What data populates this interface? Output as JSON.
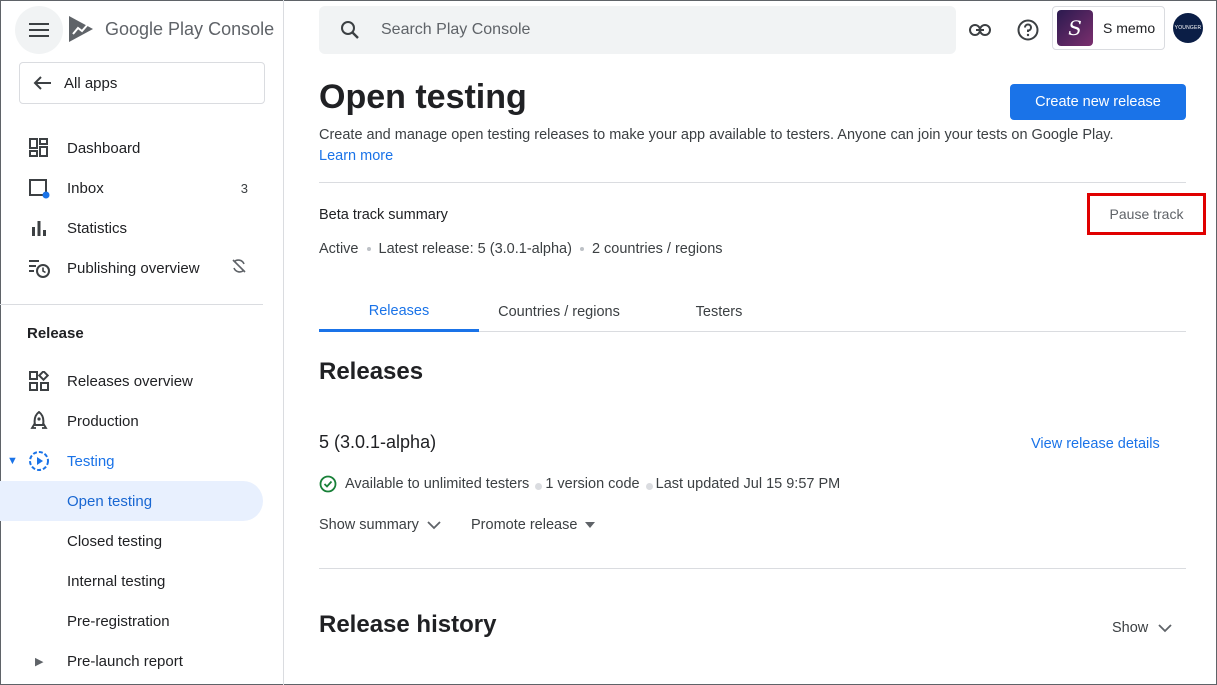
{
  "header": {
    "brand_google": "Google Play",
    "brand_console": "Console",
    "search_placeholder": "Search Play Console",
    "app_name": "S memo",
    "app_thumb_letter": "S",
    "avatar_text": "YOUNGER"
  },
  "sidebar": {
    "all_apps": "All apps",
    "items": [
      {
        "label": "Dashboard"
      },
      {
        "label": "Inbox",
        "count": "3"
      },
      {
        "label": "Statistics"
      },
      {
        "label": "Publishing overview"
      }
    ],
    "section_release": "Release",
    "release_items": [
      {
        "label": "Releases overview"
      },
      {
        "label": "Production"
      },
      {
        "label": "Testing"
      },
      {
        "label": "Open testing"
      },
      {
        "label": "Closed testing"
      },
      {
        "label": "Internal testing"
      },
      {
        "label": "Pre-registration"
      },
      {
        "label": "Pre-launch report"
      }
    ]
  },
  "main": {
    "title": "Open testing",
    "create_button": "Create new release",
    "description": "Create and manage open testing releases to make your app available to testers. Anyone can join your tests on Google Play.",
    "learn_more": "Learn more",
    "summary_title": "Beta track summary",
    "pause_track": "Pause track",
    "status": "Active",
    "latest_release": "Latest release: 5 (3.0.1-alpha)",
    "countries": "2 countries / regions",
    "tabs": [
      {
        "label": "Releases"
      },
      {
        "label": "Countries / regions"
      },
      {
        "label": "Testers"
      }
    ],
    "releases_heading": "Releases",
    "release": {
      "name": "5 (3.0.1-alpha)",
      "view_details": "View release details",
      "availability": "Available to unlimited testers",
      "version_codes": "1 version code",
      "last_updated": "Last updated Jul 15 9:57 PM",
      "show_summary": "Show summary",
      "promote_release": "Promote release"
    },
    "history_heading": "Release history",
    "history_show": "Show"
  },
  "colors": {
    "accent": "#1a73e8",
    "highlight_box": "#e00000",
    "active_nav_bg": "#e8f0fe"
  }
}
